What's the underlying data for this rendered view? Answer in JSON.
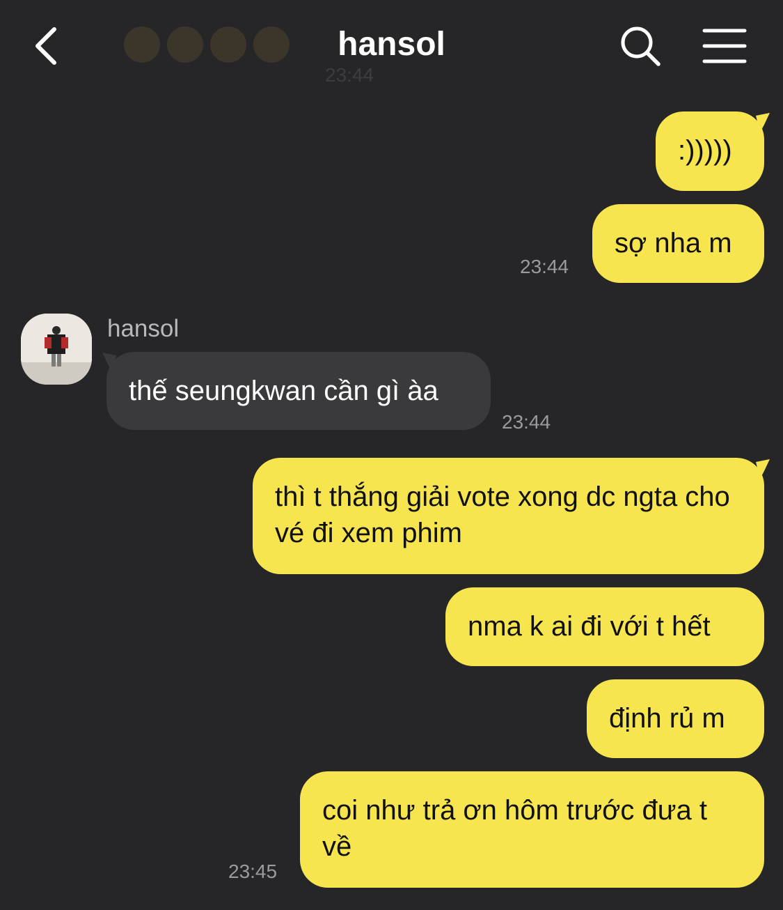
{
  "header": {
    "title": "hansol",
    "faded_previous_time": "23:44"
  },
  "icons": {
    "back": "chevron-left-icon",
    "search": "search-icon",
    "menu": "hamburger-menu-icon"
  },
  "colors": {
    "background": "#262628",
    "outgoing_bubble": "#f6e54e",
    "incoming_bubble": "#3a3a3c",
    "timestamp": "#9b9b9f"
  },
  "messages": [
    {
      "direction": "out",
      "text": ":)))))"
    },
    {
      "direction": "out",
      "text": "sợ nha m",
      "time": "23:44"
    },
    {
      "direction": "in",
      "sender": "hansol",
      "text": "thế seungkwan cần gì àa",
      "time": "23:44"
    },
    {
      "direction": "out",
      "text": "thì t thắng giải vote xong dc ngta cho vé đi xem phim"
    },
    {
      "direction": "out",
      "text": "nma k ai đi với t hết"
    },
    {
      "direction": "out",
      "text": "định rủ m"
    },
    {
      "direction": "out",
      "text": "coi như trả ơn hôm trước đưa t về",
      "time": "23:45"
    }
  ]
}
